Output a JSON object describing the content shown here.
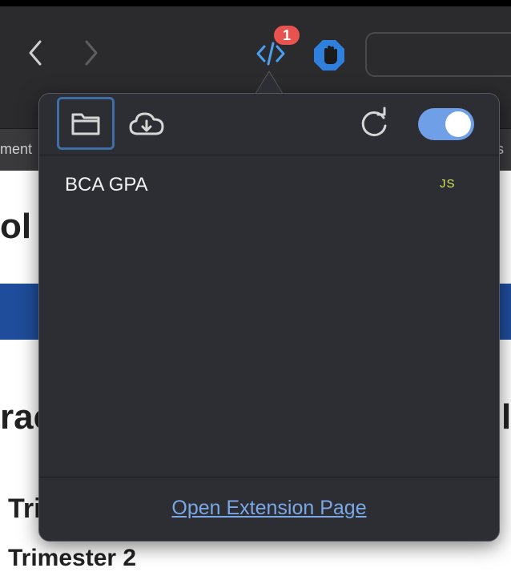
{
  "toolbar": {
    "badge_count": "1"
  },
  "bookmarks": {
    "left_fragment": "ment",
    "right_fragment": "s I"
  },
  "page": {
    "heading_fragment": "ol S",
    "subheading_fragment": "rac",
    "subheading_right_fragment": "ls",
    "trimester_1_fragment": "Tri",
    "trimester_2": "Trimester 2",
    "band_color": "#1f4d9b"
  },
  "popover": {
    "icons": {
      "folder": "folder-icon",
      "download": "cloud-download-icon",
      "refresh": "refresh-icon"
    },
    "toggle_on": true,
    "accent_color": "#6f9fe6",
    "scripts": [
      {
        "name": "BCA GPA",
        "type": "JS"
      }
    ],
    "footer_link": "Open Extension Page"
  }
}
